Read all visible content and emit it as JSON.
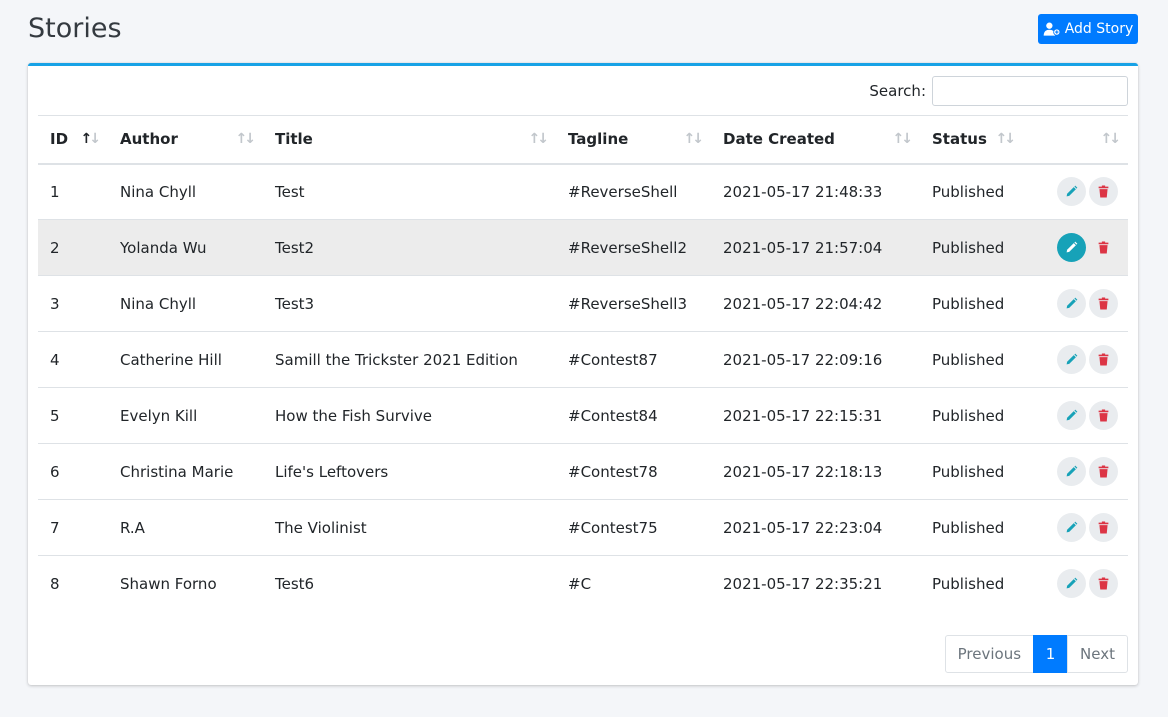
{
  "page": {
    "title": "Stories"
  },
  "toolbar": {
    "add_label": "Add Story",
    "add_icon": "user-plus-icon"
  },
  "search": {
    "label": "Search:",
    "value": "",
    "placeholder": ""
  },
  "table": {
    "columns": [
      "ID",
      "Author",
      "Title",
      "Tagline",
      "Date Created",
      "Status",
      ""
    ],
    "sorted_column": "ID",
    "rows": [
      {
        "id": "1",
        "author": "Nina Chyll",
        "title": "Test",
        "tagline": "#ReverseShell",
        "date": "2021-05-17 21:48:33",
        "status": "Published"
      },
      {
        "id": "2",
        "author": "Yolanda Wu",
        "title": "Test2",
        "tagline": "#ReverseShell2",
        "date": "2021-05-17 21:57:04",
        "status": "Published"
      },
      {
        "id": "3",
        "author": "Nina Chyll",
        "title": "Test3",
        "tagline": "#ReverseShell3",
        "date": "2021-05-17 22:04:42",
        "status": "Published"
      },
      {
        "id": "4",
        "author": "Catherine Hill",
        "title": "Samill the Trickster 2021 Edition",
        "tagline": "#Contest87",
        "date": "2021-05-17 22:09:16",
        "status": "Published"
      },
      {
        "id": "5",
        "author": "Evelyn Kill",
        "title": "How the Fish Survive",
        "tagline": "#Contest84",
        "date": "2021-05-17 22:15:31",
        "status": "Published"
      },
      {
        "id": "6",
        "author": "Christina Marie",
        "title": "Life's Leftovers",
        "tagline": "#Contest78",
        "date": "2021-05-17 22:18:13",
        "status": "Published"
      },
      {
        "id": "7",
        "author": "R.A",
        "title": "The Violinist",
        "tagline": "#Contest75",
        "date": "2021-05-17 22:23:04",
        "status": "Published"
      },
      {
        "id": "8",
        "author": "Shawn Forno",
        "title": "Test6",
        "tagline": "#C",
        "date": "2021-05-17 22:35:21",
        "status": "Published"
      }
    ],
    "hovered_row": 2
  },
  "pagination": {
    "previous": "Previous",
    "current": "1",
    "next": "Next"
  },
  "colors": {
    "primary": "#007bff",
    "info": "#17a2b8",
    "danger": "#dc3545",
    "card_top": "#17a2e6"
  },
  "icons": {
    "edit": "pencil-icon",
    "delete": "trash-icon",
    "sort": "sort-arrows-icon"
  }
}
